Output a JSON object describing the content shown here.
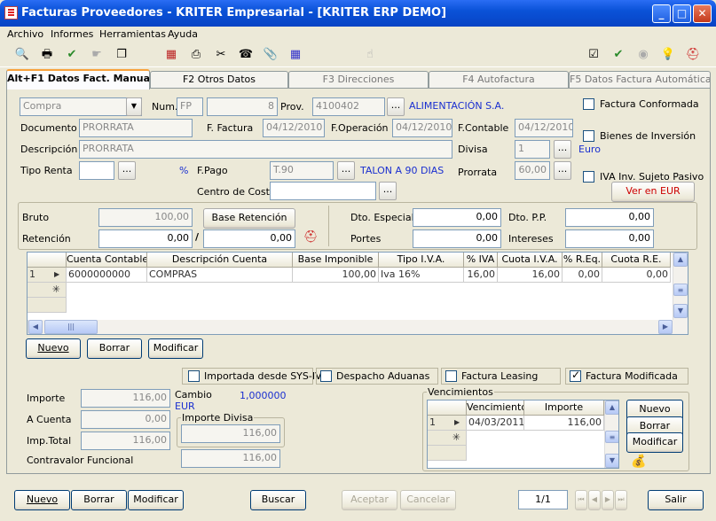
{
  "window": {
    "title": "Facturas Proveedores  - KRITER Empresarial - [KRITER ERP DEMO]"
  },
  "menu": [
    "Archivo",
    "Informes",
    "Herramientas",
    "Ayuda"
  ],
  "tabs": [
    "Alt+F1 Datos Fact. Manual",
    "F2 Otros Datos",
    "F3 Direcciones",
    "F4 Autofactura",
    "F5 Datos Factura Automática"
  ],
  "header": {
    "tipo": "Compra",
    "num_label": "Num.",
    "num_serie": "FP",
    "num_value": "8",
    "prov_label": "Prov.",
    "prov_code": "4100402",
    "prov_name": "ALIMENTACIÓN S.A.",
    "documento_label": "Documento",
    "documento": "PRORRATA",
    "ffactura_label": "F. Factura",
    "ffactura": "04/12/2010",
    "foperacion_label": "F.Operación",
    "foperacion": "04/12/2010",
    "fcontable_label": "F.Contable",
    "fcontable": "04/12/2010",
    "descripcion_label": "Descripción",
    "descripcion": "PRORRATA",
    "divisa_label": "Divisa",
    "divisa": "1",
    "divisa_name": "Euro",
    "tiporenta_label": "Tipo Renta",
    "pct": "%",
    "fpago_label": "F.Pago",
    "fpago_code": "T.90",
    "fpago_name": "TALON A 90 DIAS",
    "prorrata_label": "Prorrata",
    "prorrata": "60,00",
    "centro_label": "Centro de Coste",
    "chk_conformada": "Factura Conformada",
    "chk_inversion": "Bienes de Inversión",
    "chk_iva": "IVA Inv. Sujeto Pasivo",
    "ver_eur": "Ver en EUR"
  },
  "totals": {
    "bruto_label": "Bruto",
    "bruto": "100,00",
    "base_ret_label": "Base Retención",
    "retencion_label": "Retención",
    "retencion": "0,00",
    "slash": "/",
    "base_ret": "0,00",
    "dto_esp_label": "Dto. Especial",
    "dto_esp": "0,00",
    "dto_pp_label": "Dto. P.P.",
    "dto_pp": "0,00",
    "portes_label": "Portes",
    "portes": "0,00",
    "intereses_label": "Intereses",
    "intereses": "0,00"
  },
  "lines": {
    "columns": [
      "Cuenta Contable",
      "Descripción Cuenta",
      "Base Imponible",
      "Tipo I.V.A.",
      "% IVA",
      "Cuota I.V.A.",
      "% R.Eq.",
      "Cuota R.E."
    ],
    "rows": [
      {
        "n": "1",
        "cuenta": "6000000000",
        "desc": "COMPRAS",
        "base": "100,00",
        "tipo": "Iva 16%",
        "piva": "16,00",
        "cuota": "16,00",
        "req": "0,00",
        "cuotare": "0,00"
      }
    ]
  },
  "line_buttons": [
    "Nuevo",
    "Borrar",
    "Modificar"
  ],
  "flags": [
    "Importada desde SYS-IV",
    "Despacho Aduanas",
    "Factura Leasing",
    "Factura Modificada"
  ],
  "amounts": {
    "importe_label": "Importe",
    "importe": "116,00",
    "acuenta_label": "A Cuenta",
    "acuenta": "0,00",
    "imptotal_label": "Imp.Total",
    "imptotal": "116,00",
    "contravalor_label": "Contravalor Funcional",
    "contravalor": "116,00",
    "cambio_label": "Cambio",
    "cambio": "1,000000",
    "eur": "EUR",
    "impdivisa_label": "Importe Divisa",
    "impdivisa": "116,00"
  },
  "vencimientos": {
    "title": "Vencimientos",
    "columns": [
      "Vencimiento",
      "Importe"
    ],
    "rows": [
      {
        "n": "1",
        "fecha": "04/03/2011",
        "importe": "116,00"
      }
    ],
    "buttons": [
      "Nuevo",
      "Borrar",
      "Modificar"
    ]
  },
  "footer": {
    "nuevo": "Nuevo",
    "borrar": "Borrar",
    "modificar": "Modificar",
    "buscar": "Buscar",
    "aceptar": "Aceptar",
    "cancelar": "Cancelar",
    "page": "1/1",
    "salir": "Salir"
  }
}
